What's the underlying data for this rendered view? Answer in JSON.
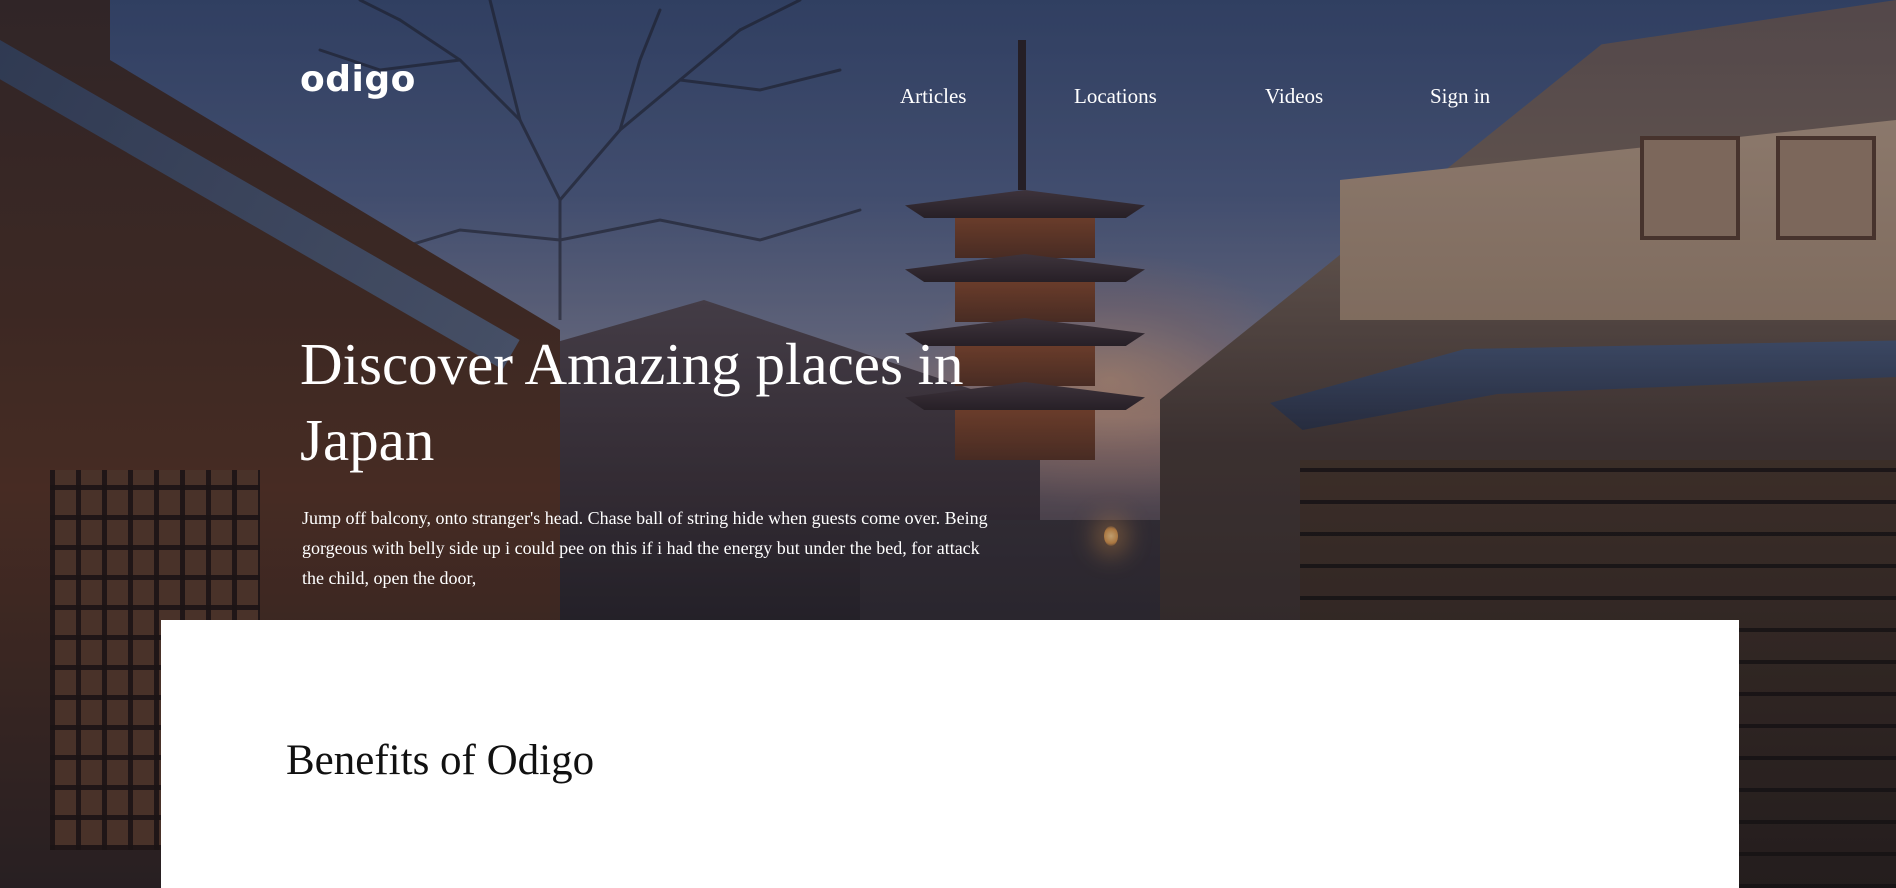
{
  "header": {
    "logo": "odigo",
    "nav": {
      "articles": "Articles",
      "locations": "Locations",
      "videos": "Videos",
      "sign_in": "Sign in"
    }
  },
  "hero": {
    "title": "Discover Amazing places in Japan",
    "description": "Jump off balcony, onto stranger's head. Chase ball of string hide when guests come over. Being gorgeous with belly side up i could pee on this if i had the energy but under the bed, for attack the child, open the door,"
  },
  "benefits": {
    "title": "Benefits of Odigo"
  },
  "colors": {
    "text_on_image": "#ffffff",
    "card_background": "#ffffff",
    "heading_dark": "#111111"
  }
}
